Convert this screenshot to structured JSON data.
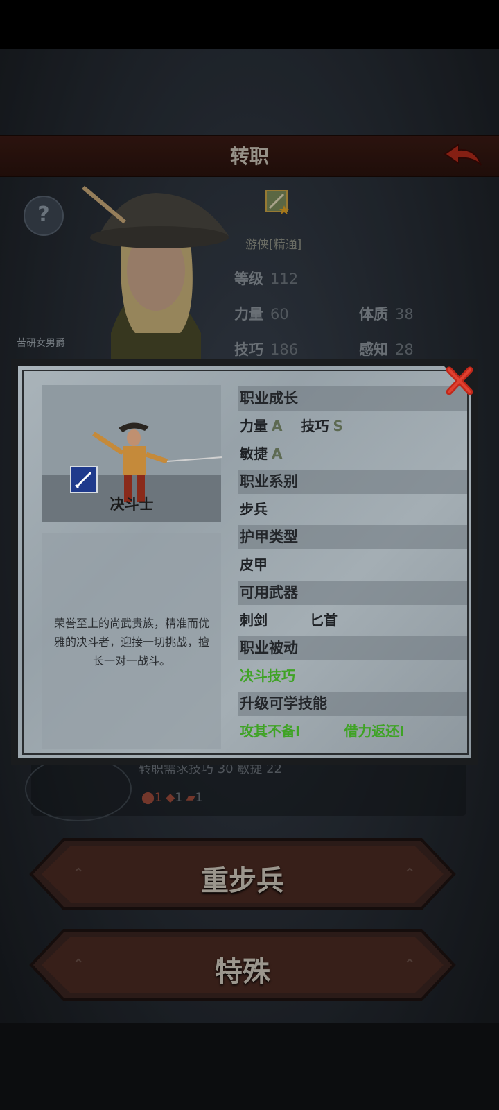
{
  "header": {
    "title": "转职"
  },
  "character": {
    "name": "苦研女男爵",
    "class_name": "游侠[精通]",
    "stats": [
      {
        "label": "等级",
        "value": "112"
      },
      {
        "label": "力量",
        "value": "60"
      },
      {
        "label": "体质",
        "value": "38"
      },
      {
        "label": "技巧",
        "value": "186"
      },
      {
        "label": "感知",
        "value": "28"
      }
    ]
  },
  "requirement": {
    "text": "转职需求技巧 30 敏捷 22",
    "items": [
      "1",
      "1",
      "1"
    ]
  },
  "buttons": {
    "heavy_infantry": "重步兵",
    "special": "特殊"
  },
  "modal": {
    "job_name": "决斗士",
    "description": "荣誉至上的尚武贵族，精准而优雅的决斗者，迎接一切挑战，擅长一对一战斗。",
    "growth_header": "职业成长",
    "growth": [
      {
        "stat": "力量",
        "grade": "A"
      },
      {
        "stat": "技巧",
        "grade": "S"
      },
      {
        "stat": "敏捷",
        "grade": "A"
      }
    ],
    "series_header": "职业系别",
    "series": "步兵",
    "armor_header": "护甲类型",
    "armor": "皮甲",
    "weapons_header": "可用武器",
    "weapons": [
      "刺剑",
      "匕首"
    ],
    "passive_header": "职业被动",
    "passive": "决斗技巧",
    "skills_header": "升级可学技能",
    "skills": [
      "攻其不备I",
      "借力返还I"
    ]
  },
  "colors": {
    "skill_green": "#3fa325",
    "header_red": "#3a1a14"
  }
}
